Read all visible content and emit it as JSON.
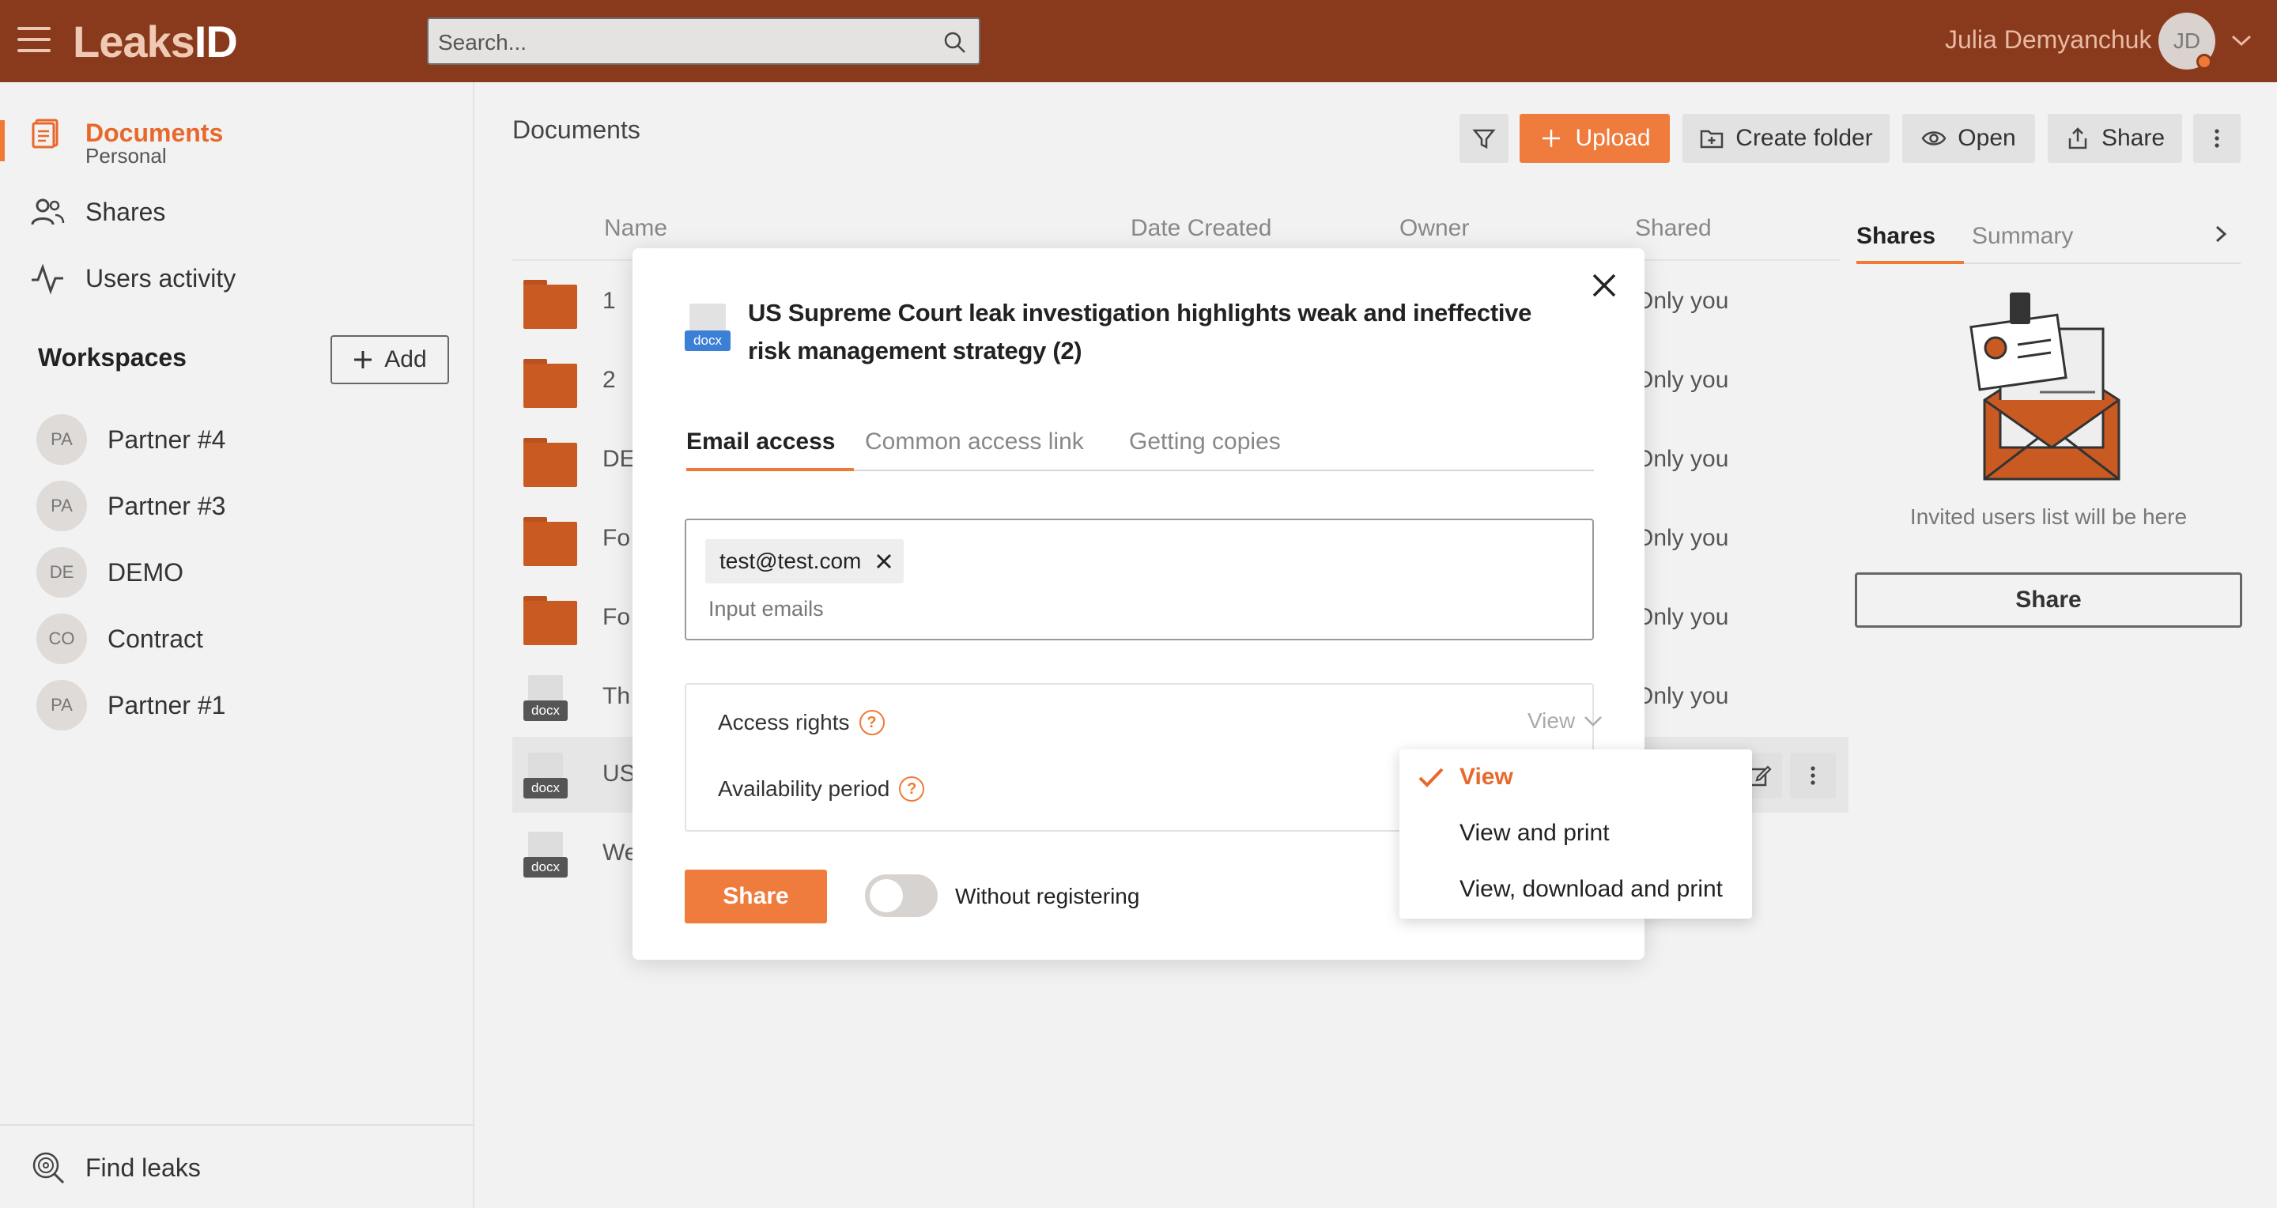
{
  "header": {
    "logo_light": "Leaks",
    "logo_bold": "ID",
    "search_placeholder": "Search...",
    "user_name": "Julia Demyanchuk",
    "user_initials": "JD"
  },
  "sidebar": {
    "nav": [
      {
        "label": "Documents",
        "sublabel": "Personal",
        "icon": "documents-icon",
        "active": true
      },
      {
        "label": "Shares",
        "icon": "users-icon"
      },
      {
        "label": "Users activity",
        "icon": "activity-icon"
      }
    ],
    "workspaces_title": "Workspaces",
    "add_label": "Add",
    "workspaces": [
      {
        "initials": "PA",
        "name": "Partner #4"
      },
      {
        "initials": "PA",
        "name": "Partner #3"
      },
      {
        "initials": "DE",
        "name": "DEMO"
      },
      {
        "initials": "CO",
        "name": "Contract"
      },
      {
        "initials": "PA",
        "name": "Partner #1"
      }
    ],
    "find_leaks": "Find leaks"
  },
  "main": {
    "title": "Documents",
    "toolbar": {
      "upload": "Upload",
      "create_folder": "Create folder",
      "open": "Open",
      "share": "Share"
    },
    "columns": [
      "Name",
      "Date Created",
      "Owner",
      "Shared"
    ],
    "rows": [
      {
        "type": "folder",
        "name": "1",
        "shared": "Only you"
      },
      {
        "type": "folder",
        "name": "2",
        "shared": "Only you"
      },
      {
        "type": "folder",
        "name": "DE",
        "shared": "Only you"
      },
      {
        "type": "folder",
        "name": "Fo",
        "shared": "Only you"
      },
      {
        "type": "folder",
        "name": "Fo",
        "shared": "Only you"
      },
      {
        "type": "docx",
        "name": "Th",
        "shared": "Only you"
      },
      {
        "type": "docx",
        "name": "US",
        "shared": ""
      },
      {
        "type": "docx",
        "name": "We",
        "shared": ""
      }
    ],
    "docx_label": "docx"
  },
  "right_panel": {
    "tabs": [
      "Shares",
      "Summary"
    ],
    "empty_text": "Invited users list will be here",
    "share_button": "Share"
  },
  "modal": {
    "doc_label": "docx",
    "title": "US Supreme Court leak investigation highlights weak and ineffective risk management strategy (2)",
    "tabs": [
      "Email access",
      "Common access link",
      "Getting copies"
    ],
    "email_chip": "test@test.com",
    "email_placeholder": "Input emails",
    "access_rights_label": "Access rights",
    "availability_label": "Availability period",
    "access_value": "View",
    "share_button": "Share",
    "toggle_label": "Without registering",
    "toggle_on": false
  },
  "dropdown": {
    "options": [
      "View",
      "View and print",
      "View, download and print"
    ],
    "selected": "View"
  },
  "colors": {
    "header_bg": "#8a3a1c",
    "accent": "#ef7b3d",
    "folder": "#c95a22"
  }
}
